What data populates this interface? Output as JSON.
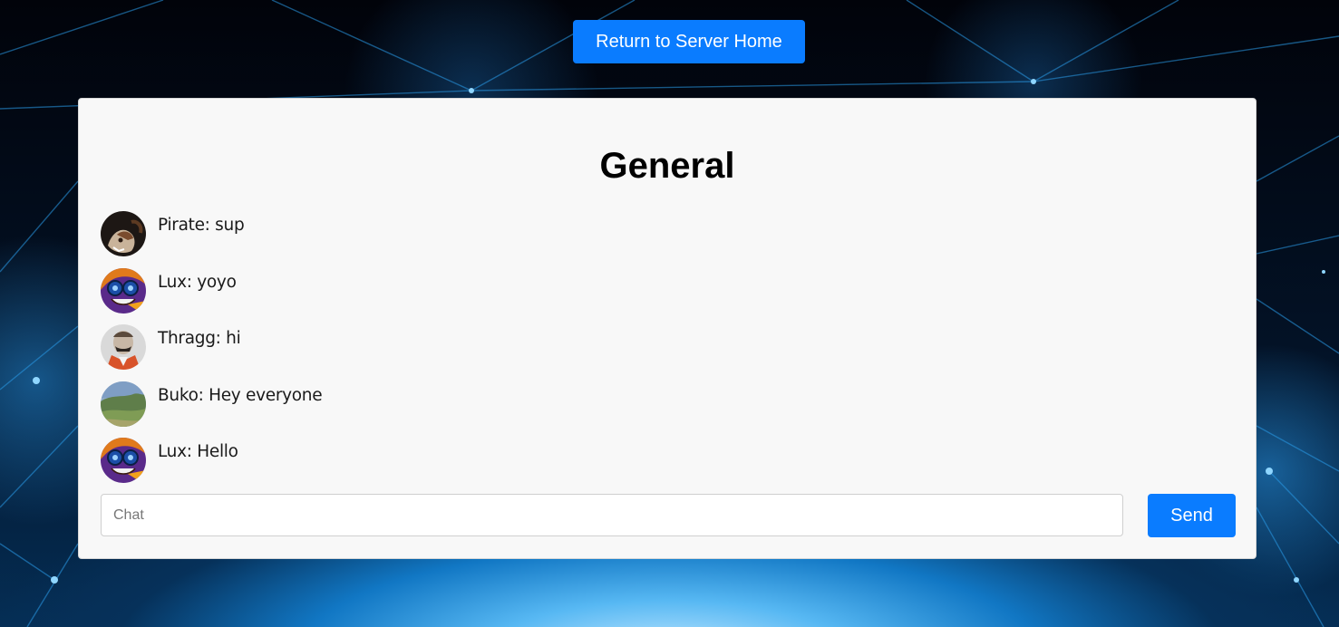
{
  "header": {
    "home_button_label": "Return to Server Home"
  },
  "channel": {
    "title": "General"
  },
  "messages": [
    {
      "text": "Pirate: sup",
      "avatar": "pirate-avatar"
    },
    {
      "text": "Lux: yoyo",
      "avatar": "lux-avatar"
    },
    {
      "text": "Thragg: hi",
      "avatar": "thragg-avatar"
    },
    {
      "text": "Buko: Hey everyone",
      "avatar": "buko-avatar"
    },
    {
      "text": "Lux: Hello",
      "avatar": "lux-avatar"
    }
  ],
  "composer": {
    "placeholder": "Chat",
    "value": "",
    "send_label": "Send"
  },
  "colors": {
    "accent": "#0a7cff",
    "panel": "#f8f8f8",
    "background": "#031226"
  }
}
